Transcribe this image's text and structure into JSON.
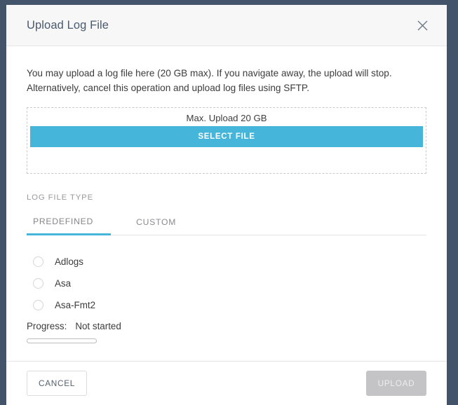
{
  "backdrop": {
    "color": "#43546a"
  },
  "modal": {
    "title": "Upload Log File",
    "close_icon": "close-icon",
    "description_line1": "You may upload a log file here (20 GB max). If you navigate away, the upload will stop.",
    "description_line2": "Alternatively, cancel this operation and upload log files using SFTP.",
    "dropzone": {
      "hint": "Max. Upload 20 GB",
      "select_file_label": "SELECT FILE",
      "accent_color": "#45b5da"
    },
    "log_file_type": {
      "section_label": "LOG FILE TYPE",
      "tabs": [
        {
          "label": "PREDEFINED",
          "active": true
        },
        {
          "label": "CUSTOM",
          "active": false
        }
      ],
      "options": [
        {
          "label": "Adlogs",
          "selected": false
        },
        {
          "label": "Asa",
          "selected": false
        },
        {
          "label": "Asa-Fmt2",
          "selected": false
        }
      ]
    },
    "progress": {
      "caption": "Progress:",
      "status": "Not started",
      "percent": 0
    },
    "footer": {
      "cancel_label": "CANCEL",
      "upload_label": "UPLOAD",
      "upload_disabled": true
    }
  }
}
